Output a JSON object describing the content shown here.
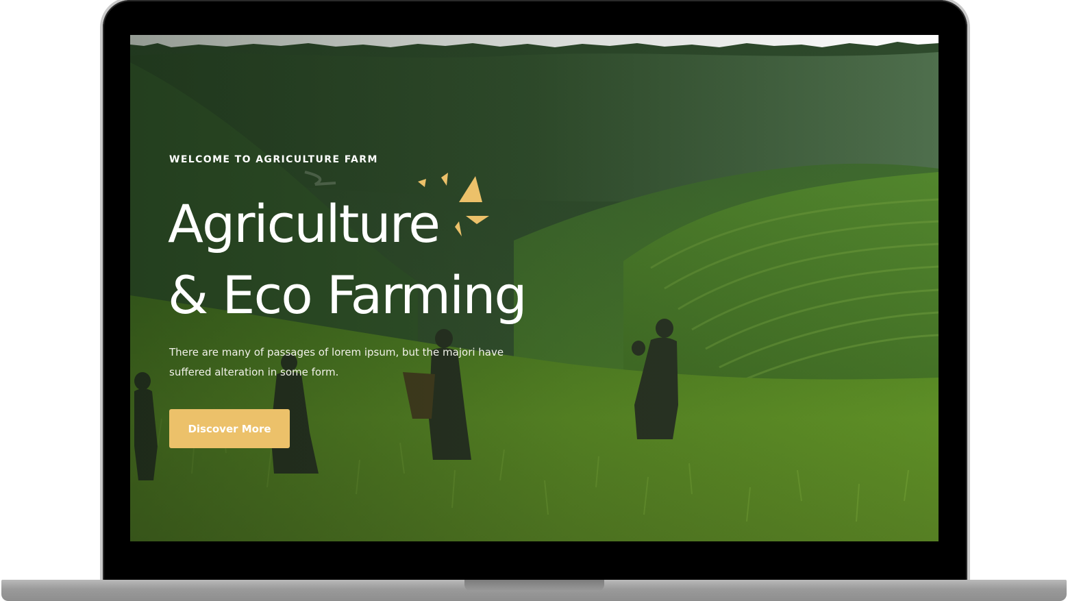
{
  "hero": {
    "eyebrow": "WELCOME TO AGRICULTURE FARM",
    "title_line_1": "Agriculture",
    "title_line_2": "& Eco Farming",
    "description": "There are many of passages of lorem ipsum, but the majori have suffered alteration in some form.",
    "cta_label": "Discover More"
  },
  "icons": {
    "decoration": "sparkle-icon"
  },
  "colors": {
    "accent": "#ecc16a",
    "hero_overlay": "#1f3f1c",
    "text": "#ffffff"
  }
}
